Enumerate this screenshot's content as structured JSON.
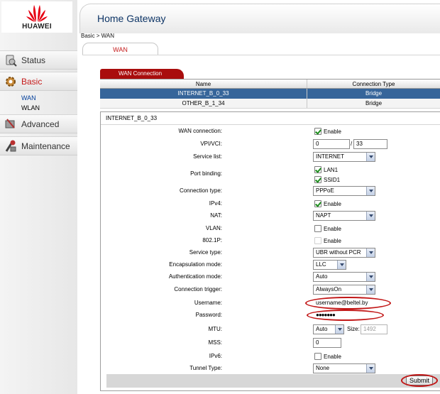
{
  "brand": {
    "name": "HUAWEI",
    "color": "#e60012"
  },
  "header": {
    "title": "Home Gateway"
  },
  "breadcrumb": "Basic > WAN",
  "tab": {
    "label": "WAN"
  },
  "sidebar": {
    "items": [
      {
        "label": "Status",
        "icon": "status-icon"
      },
      {
        "label": "Basic",
        "icon": "gear-icon",
        "active": true
      },
      {
        "label": "Advanced",
        "icon": "tools-icon"
      },
      {
        "label": "Maintenance",
        "icon": "maintenance-icon"
      }
    ],
    "subitems": [
      {
        "label": "WAN",
        "current": true
      },
      {
        "label": "WLAN"
      }
    ]
  },
  "wan_table": {
    "tab_label": "WAN Connection",
    "columns": [
      "Name",
      "Connection Type"
    ],
    "rows": [
      {
        "name": "INTERNET_B_0_33",
        "type": "Bridge",
        "selected": true
      },
      {
        "name": "OTHER_B_1_34",
        "type": "Bridge",
        "selected": false
      }
    ]
  },
  "form": {
    "title": "INTERNET_B_0_33",
    "enable_text": "Enable",
    "fields": {
      "wan_connection": {
        "label": "WAN connection:",
        "checked": true
      },
      "vpi_vci": {
        "label": "VPI/VCI:",
        "vpi": "0",
        "separator": "/",
        "vci": "33"
      },
      "service_list": {
        "label": "Service list:",
        "value": "INTERNET"
      },
      "port_binding": {
        "label": "Port binding:",
        "ports": [
          {
            "name": "LAN1",
            "checked": true
          },
          {
            "name": "SSID1",
            "checked": true
          }
        ]
      },
      "connection_type": {
        "label": "Connection type:",
        "value": "PPPoE"
      },
      "ipv4": {
        "label": "IPv4:",
        "checked": true
      },
      "nat": {
        "label": "NAT:",
        "value": "NAPT"
      },
      "vlan": {
        "label": "VLAN:",
        "checked": false
      },
      "p8021": {
        "label": "802.1P:",
        "checked": false
      },
      "service_type": {
        "label": "Service type:",
        "value": "UBR without PCR"
      },
      "encapsulation": {
        "label": "Encapsulation mode:",
        "value": "LLC"
      },
      "auth_mode": {
        "label": "Authentication mode:",
        "value": "Auto"
      },
      "trigger": {
        "label": "Connection trigger:",
        "value": "AlwaysOn"
      },
      "username": {
        "label": "Username:",
        "value": "username@beltel.by"
      },
      "password": {
        "label": "Password:",
        "value": "●●●●●●●"
      },
      "mtu": {
        "label": "MTU:",
        "value": "Auto",
        "size_label": "Size:",
        "size": "1492"
      },
      "mss": {
        "label": "MSS:",
        "value": "0"
      },
      "ipv6": {
        "label": "IPv6:",
        "checked": false
      },
      "tunnel_type": {
        "label": "Tunnel Type:",
        "value": "None"
      }
    },
    "submit_label": "Submit"
  },
  "highlight_color": "#c21717"
}
